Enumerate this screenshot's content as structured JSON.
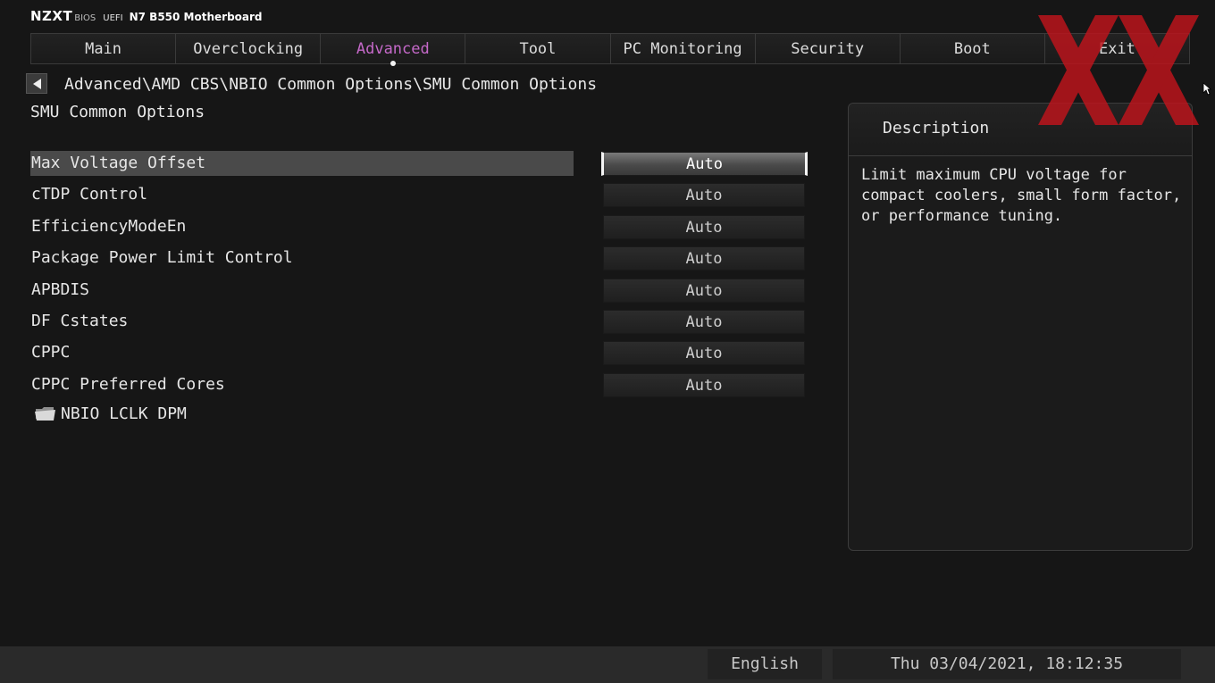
{
  "header": {
    "logo": "NZXT",
    "bios_label": "BIOS",
    "uefi_label": "UEFI",
    "board_name": "N7 B550 Motherboard"
  },
  "tabs": [
    {
      "label": "Main"
    },
    {
      "label": "Overclocking"
    },
    {
      "label": "Advanced"
    },
    {
      "label": "Tool"
    },
    {
      "label": "PC Monitoring"
    },
    {
      "label": "Security"
    },
    {
      "label": "Boot"
    },
    {
      "label": "Exit"
    }
  ],
  "active_tab": "Advanced",
  "breadcrumb": "Advanced\\AMD CBS\\NBIO Common Options\\SMU Common Options",
  "page_title": "SMU Common Options",
  "settings": [
    {
      "label": "Max Voltage Offset",
      "value": "Auto"
    },
    {
      "label": "cTDP Control",
      "value": "Auto"
    },
    {
      "label": "EfficiencyModeEn",
      "value": "Auto"
    },
    {
      "label": "Package Power Limit Control",
      "value": "Auto"
    },
    {
      "label": "APBDIS",
      "value": "Auto"
    },
    {
      "label": "DF Cstates",
      "value": "Auto"
    },
    {
      "label": "CPPC",
      "value": "Auto"
    },
    {
      "label": "CPPC Preferred Cores",
      "value": "Auto"
    }
  ],
  "selected_setting": "Max Voltage Offset",
  "submenu": {
    "label": "NBIO LCLK DPM",
    "icon": "folder-icon"
  },
  "description": {
    "title": "Description",
    "text": "Limit maximum CPU voltage for compact coolers, small form factor, or performance tuning."
  },
  "footer": {
    "language": "English",
    "datetime": "Thu 03/04/2021, 18:12:35"
  },
  "colors": {
    "active_tab": "#c569c9",
    "background": "#161616",
    "watermark": "#c0141c"
  }
}
